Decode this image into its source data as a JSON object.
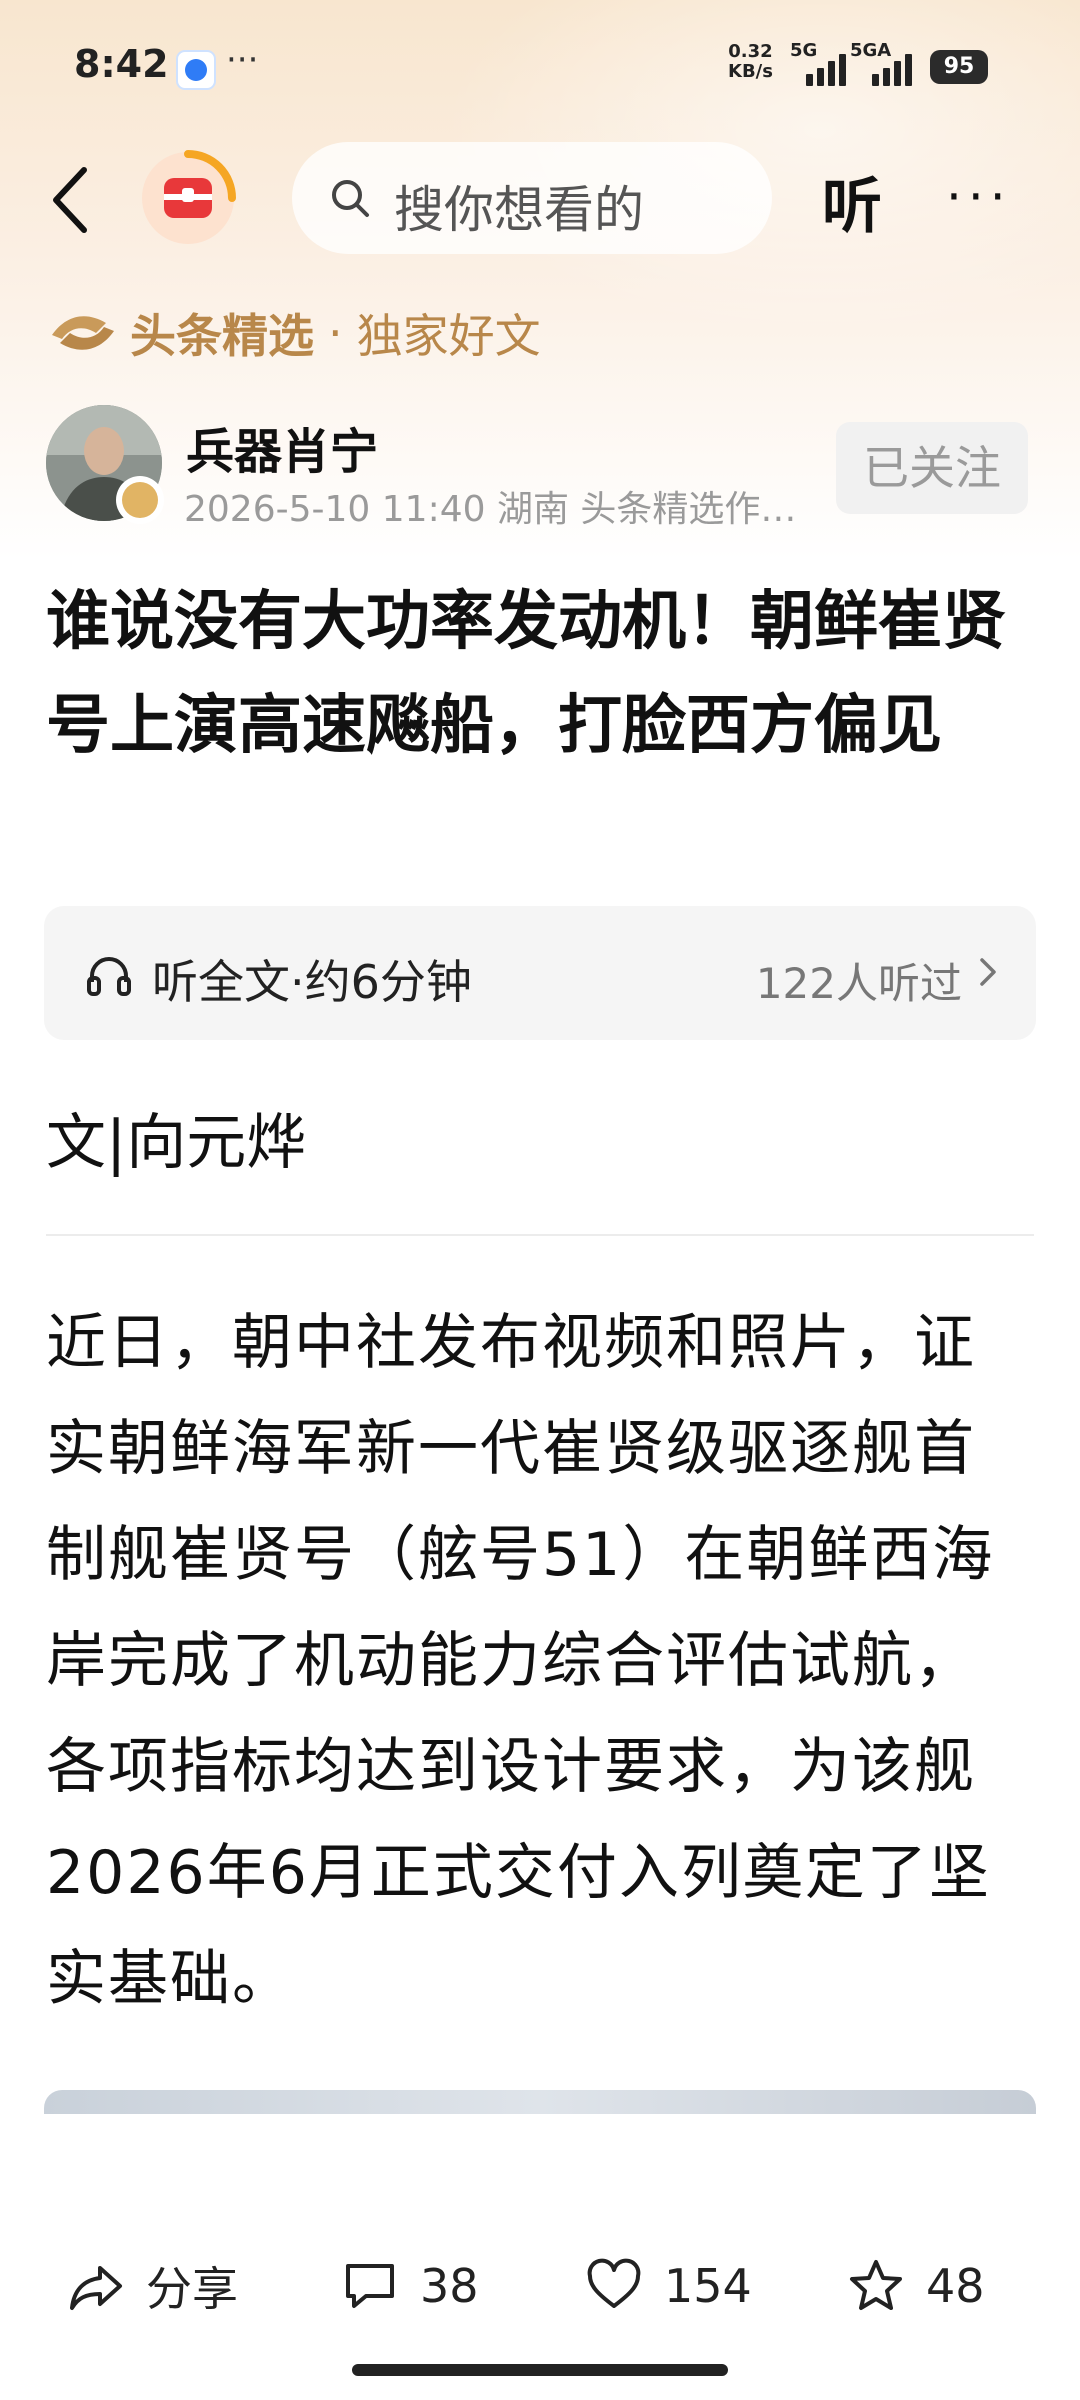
{
  "status_bar": {
    "time": "8:42",
    "dots": "···",
    "net_speed_value": "0.32",
    "net_speed_unit": "KB/s",
    "signal1": "5G",
    "signal2": "5GA",
    "battery": "95"
  },
  "nav": {
    "search_placeholder": "搜你想看的",
    "listen_label": "听",
    "more_label": "···"
  },
  "channel": {
    "brand": "头条精选",
    "separator": "·",
    "subtitle": "独家好文"
  },
  "author": {
    "name": "兵器肖宁",
    "meta": "2026-5-10  11:40  湖南  头条精选作…",
    "follow_label": "已关注"
  },
  "article": {
    "title": "谁说没有大功率发动机！朝鲜崔贤号上演高速飚船，打脸西方偏见",
    "byline": "文|向元烨",
    "body": "近日，朝中社发布视频和照片，证实朝鲜海军新一代崔贤级驱逐舰首制舰崔贤号（舷号51）在朝鲜西海岸完成了机动能力综合评估试航，各项指标均达到设计要求，为该舰2026年6月正式交付入列奠定了坚实基础。"
  },
  "listen_card": {
    "label": "听全文·约6分钟",
    "listeners": "122人听过"
  },
  "actions": {
    "share_label": "分享",
    "comments": "38",
    "likes": "154",
    "favorites": "48"
  },
  "colors": {
    "brand_gold": "#b8874a",
    "logo_red": "#e8383a",
    "logo_orange": "#f5a623"
  }
}
